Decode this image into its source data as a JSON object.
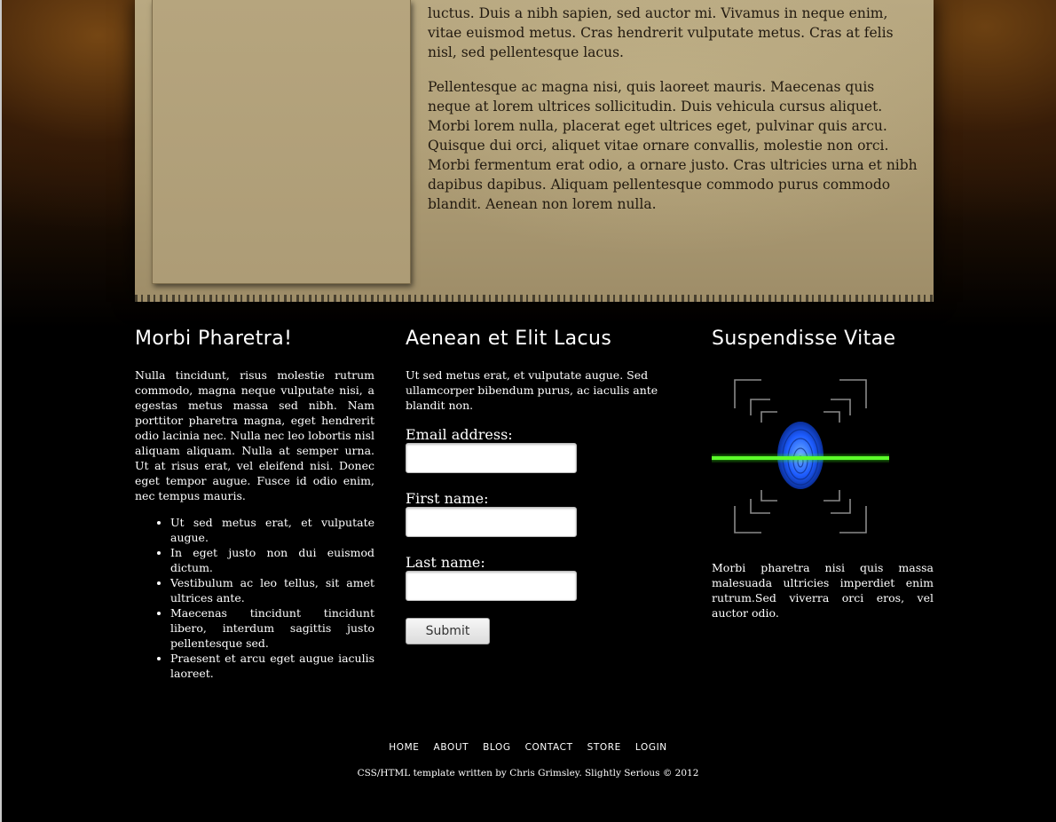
{
  "article": {
    "paragraph_1": "luctus. Duis a nibh sapien, sed auctor mi. Vivamus in neque enim, vitae euismod metus. Cras hendrerit vulputate metus. Cras at felis nisl, sed pellentesque lacus.",
    "paragraph_2": "Pellentesque ac magna nisi, quis laoreet mauris. Maecenas quis neque at lorem ultrices sollicitudin. Duis vehicula cursus aliquet. Morbi lorem nulla, placerat eget ultrices eget, pulvinar quis arcu. Quisque dui orci, aliquet vitae ornare convallis, molestie non orci. Morbi fermentum erat odio, a ornare justo. Cras ultricies urna et nibh dapibus dapibus. Aliquam pellentesque commodo purus commodo blandit. Aenean non lorem nulla."
  },
  "col1": {
    "title": "Morbi Pharetra!",
    "text": "Nulla tincidunt, risus molestie rutrum commodo, magna neque vulputate nisi, a egestas metus massa sed nibh. Nam porttitor pharetra magna, eget hendrerit odio lacinia nec. Nulla nec leo lobortis nisl aliquam aliquam. Nulla at semper urna. Ut at risus erat, vel eleifend nisi. Donec eget tempor augue. Fusce id odio enim, nec tempus mauris.",
    "list": [
      "Ut sed metus erat, et vulputate augue.",
      "In eget justo non dui euismod dictum.",
      "Vestibulum ac leo tellus, sit amet ultrices ante.",
      "Maecenas tincidunt tincidunt libero, interdum sagittis justo pellentesque sed.",
      "Praesent et arcu eget augue iaculis laoreet."
    ]
  },
  "col2": {
    "title": "Aenean et Elit Lacus",
    "text": "Ut sed metus erat, et vulputate augue. Sed ullamcorper bibendum purus, ac iaculis ante blandit non.",
    "form": {
      "email_label": "Email address:",
      "first_name_label": "First name:",
      "last_name_label": "Last name:",
      "email_value": "",
      "first_name_value": "",
      "last_name_value": "",
      "submit_label": "Submit"
    }
  },
  "col3": {
    "title": "Suspendisse Vitae",
    "image_icon": "fingerprint-scan-icon",
    "text": "Morbi pharetra nisi quis massa malesuada ultricies imperdiet enim rutrum.Sed viverra orci eros, vel auctor odio."
  },
  "footer": {
    "nav": [
      "HOME",
      "ABOUT",
      "BLOG",
      "CONTACT",
      "STORE",
      "LOGIN"
    ],
    "credit": "CSS/HTML template written by Chris Grimsley. Slightly Serious © 2012"
  },
  "colors": {
    "background": "#000000",
    "paper": "#b3a27b",
    "text_dark": "#221a10",
    "text_light": "#ffffff",
    "scan_line": "#39ff14",
    "fingerprint": "#2a6bff"
  }
}
